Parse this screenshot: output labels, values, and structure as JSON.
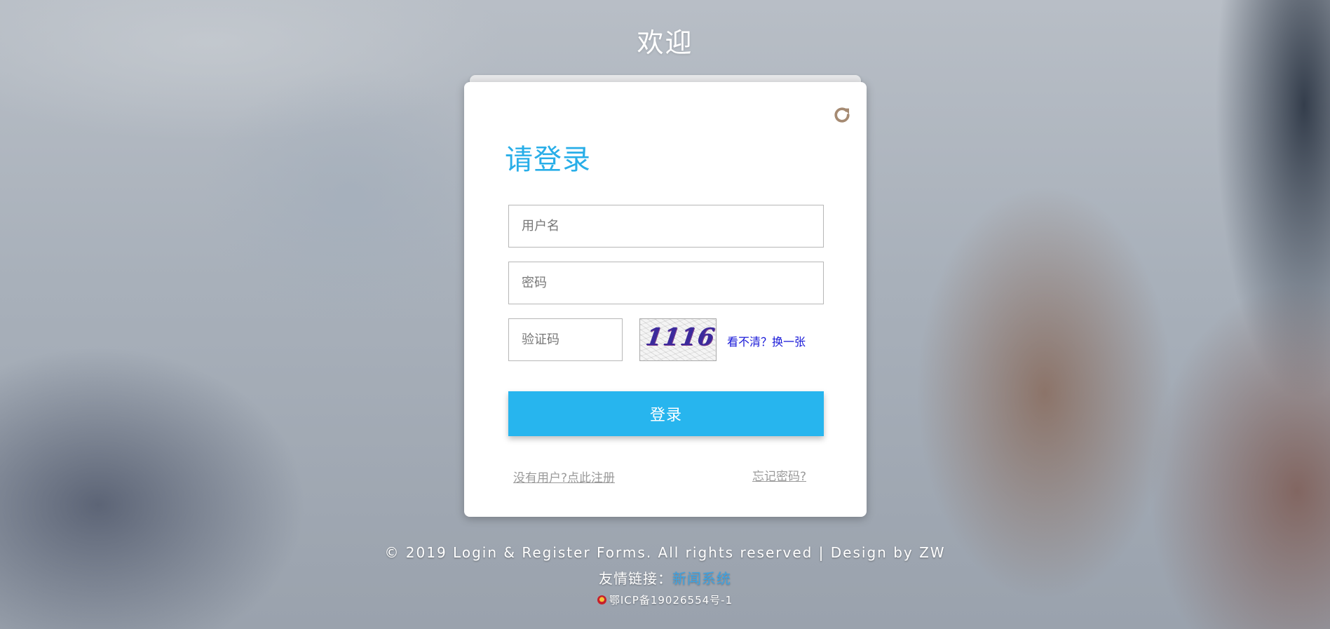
{
  "header": {
    "welcome": "欢迎"
  },
  "login": {
    "title": "请登录",
    "username_placeholder": "用户名",
    "password_placeholder": "密码",
    "captcha_placeholder": "验证码",
    "captcha_code": "1116",
    "captcha_refresh_label": "看不清？换一张",
    "submit_label": "登录",
    "register_link": "没有用户?点此注册",
    "forgot_link": "忘记密码?",
    "refresh_icon": "refresh-icon"
  },
  "footer": {
    "copyright": "© 2019 Login & Register Forms. All rights reserved | Design by ZW",
    "friend_links_label": "友情链接：",
    "friend_link": "新闻系统",
    "icp": "鄂ICP备19026554号-1"
  },
  "colors": {
    "accent": "#27b5ee",
    "title": "#28aee8",
    "link": "#1818d8",
    "refresh_icon": "#a58a72"
  }
}
